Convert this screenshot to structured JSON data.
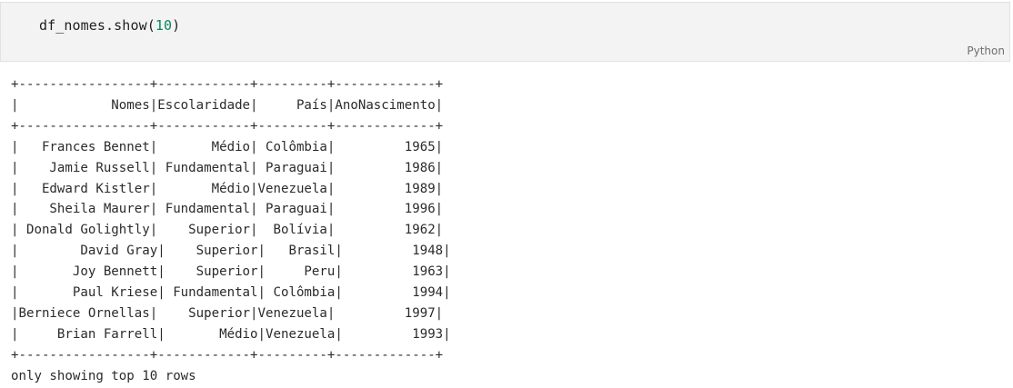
{
  "code_cell": {
    "code_prefix": "df_nomes.show(",
    "code_arg": "10",
    "code_suffix": ")",
    "language": "Python"
  },
  "output": {
    "lines": [
      "+-----------------+------------+---------+-------------+",
      "|            Nomes|Escolaridade|     País|AnoNascimento|",
      "+-----------------+------------+---------+-------------+",
      "|   Frances Bennet|       Médio| Colômbia|         1965|",
      "|    Jamie Russell| Fundamental| Paraguai|         1986|",
      "|   Edward Kistler|       Médio|Venezuela|         1989|",
      "|    Sheila Maurer| Fundamental| Paraguai|         1996|",
      "| Donald Golightly|    Superior|  Bolívia|         1962|",
      "|        David Gray|    Superior|   Brasil|         1948|",
      "|       Joy Bennett|    Superior|     Peru|         1963|",
      "|       Paul Kriese| Fundamental| Colômbia|         1994|",
      "|Berniece Ornellas|    Superior|Venezuela|         1997|",
      "|     Brian Farrell|       Médio|Venezuela|         1993|",
      "+-----------------+------------+---------+-------------+",
      "only showing top 10 rows"
    ]
  }
}
